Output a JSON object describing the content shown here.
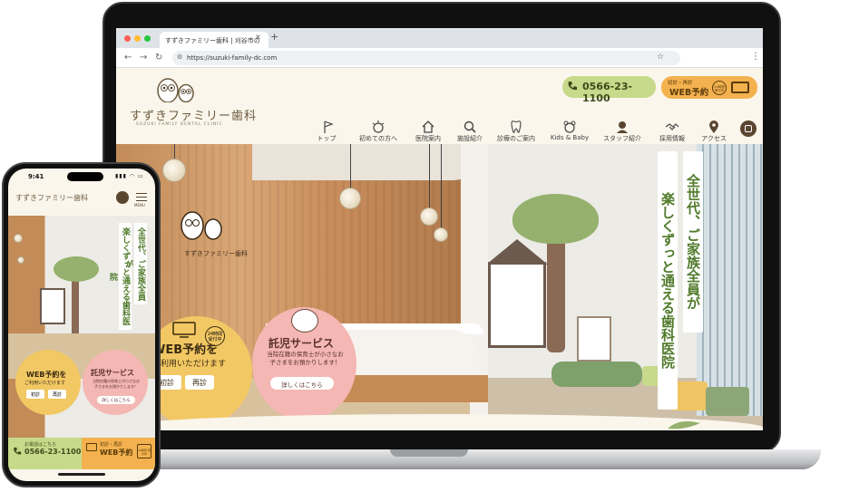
{
  "browser": {
    "tab_title": "すずきファミリー歯科 | 刈谷市の",
    "tab_close": "×",
    "tab_add": "+",
    "url": "https://suzuki-family-dc.com",
    "back_icon": "arrow-left-icon",
    "forward_icon": "arrow-right-icon",
    "reload_icon": "reload-icon",
    "bookmark_icon": "star-icon",
    "menu_icon": "kebab-icon",
    "colors": {
      "red": "#fe5f57",
      "yellow": "#febc2e",
      "green": "#28c840"
    }
  },
  "site": {
    "logo_text": "すずきファミリー歯科",
    "logo_sub": "SUZUKI FAMILY DENTAL CLINIC",
    "phone": "0566-23-1100",
    "web_small": "初診・再診",
    "web_big": "WEB予約",
    "web_24": "24時間 受付中",
    "nav": [
      {
        "label": "トップ",
        "icon": "flag-icon"
      },
      {
        "label": "初めての方へ",
        "icon": "tooth-sun-icon"
      },
      {
        "label": "医院案内",
        "icon": "house-icon"
      },
      {
        "label": "施設紹介",
        "icon": "magnifier-icon"
      },
      {
        "label": "診療のご案内",
        "icon": "tooth-icon"
      },
      {
        "label": "Kids & Baby",
        "icon": "bear-icon"
      },
      {
        "label": "スタッフ紹介",
        "icon": "staff-icon"
      },
      {
        "label": "採用情報",
        "icon": "handshake-icon"
      },
      {
        "label": "アクセス",
        "icon": "map-pin-icon"
      }
    ],
    "hero_catch_1": "全世代、ご家族全員が",
    "hero_catch_2": "楽しくずっと通える歯科医院",
    "hero_logo_text": "すずきファミリー歯科",
    "web_circle": {
      "title": "WEB予約を",
      "sub": "ご利用いただけます",
      "btn1": "初診",
      "btn2": "再診"
    },
    "care_circle": {
      "title": "託児サービス",
      "sub": "当院在籍の保育士が小さなお子さまをお預かりします！",
      "btn": "詳しくはこちら"
    },
    "colors": {
      "accent_green": "#c7d98a",
      "accent_orange": "#f3b24f",
      "catch_green": "#4f7a29",
      "bg": "#fbf6ec"
    }
  },
  "phone_ui": {
    "time": "9:41",
    "status": "▮▮▮ ◠ ▭",
    "logo_text": "すずきファミリー歯科",
    "menu_label": "MENU",
    "catch_1": "全世代、ご家族全員が",
    "catch_2": "楽しくずっと通える歯科医院",
    "web_title": "WEB予約を",
    "web_sub": "ご利用いただけます",
    "web_btn1": "初診",
    "web_btn2": "再診",
    "care_title": "託児サービス",
    "care_sub": "当院在籍の保育士が小さなお子さまをお預かりします！",
    "care_btn": "詳しくはこちら",
    "tel_label": "お電話はこちら",
    "tel_number": "0566-23-1100",
    "web_small": "初診・再診",
    "web_big": "WEB予約",
    "web_24": "24時間 受付中"
  }
}
